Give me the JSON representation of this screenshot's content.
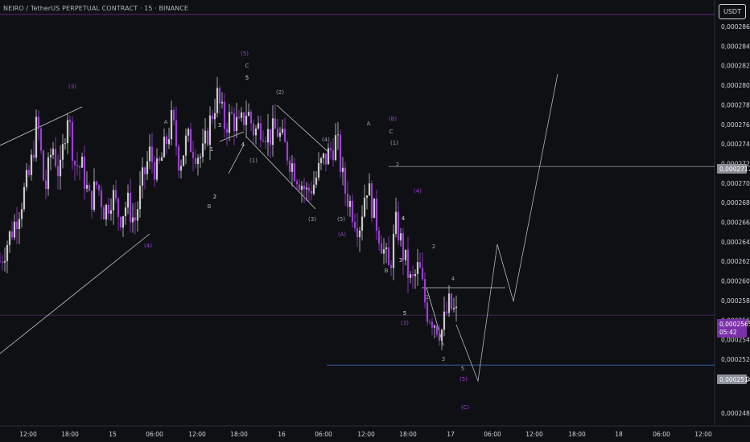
{
  "header": {
    "title": "NEIRO / TetherUS PERPETUAL CONTRACT · 15 · BINANCE"
  },
  "unit_label": "USDT",
  "colors": {
    "background": "#0f1013",
    "bull": "#c9c9c9",
    "bear": "#9b3fd6",
    "wave_label": "#9b3fd6",
    "scale_text": "#d1d4dc"
  },
  "chart_data": {
    "type": "candlestick",
    "title": "NEIRO / TetherUS PERPETUAL CONTRACT · 15 · BINANCE",
    "y_axis": {
      "ylim": [
        0.0002478,
        0.0002868
      ],
      "ticks": [
        "0,0002860",
        "0,0002840",
        "0,0002820",
        "0,0002800",
        "0,0002780",
        "0,0002760",
        "0,0002740",
        "0,0002720",
        "0,0002700",
        "0,0002680",
        "0,0002660",
        "0,0002640",
        "0,0002620",
        "0,0002600",
        "0,0002580",
        "0,0002560",
        "0,0002540",
        "0,0002520",
        "0,0002500",
        "0,0002482"
      ]
    },
    "x_axis": {
      "ticks": [
        "12:00",
        "18:00",
        "15",
        "06:00",
        "12:00",
        "18:00",
        "16",
        "06:00",
        "12:00",
        "18:00",
        "17",
        "06:00",
        "12:00",
        "18:00",
        "18",
        "06:00",
        "12:00"
      ]
    },
    "price_markers": [
      {
        "label": "0,0002717",
        "value": 0.0002717,
        "color": "#b2b5be"
      },
      {
        "label": "0,0002565",
        "sub": "05:42",
        "value": 0.0002565,
        "color": "#7b2fa8"
      },
      {
        "label": "0,0002514",
        "value": 0.0002514,
        "color": "#b2b5be"
      }
    ],
    "ohlc_path": [
      [
        0,
        0.000262
      ],
      [
        2,
        0.000266
      ],
      [
        4,
        0.000271
      ],
      [
        5,
        0.0002765
      ],
      [
        6,
        0.000269
      ],
      [
        7,
        0.000274
      ],
      [
        8,
        0.0002705
      ],
      [
        9,
        0.0002775
      ],
      [
        10,
        0.000272
      ],
      [
        11,
        0.0002715
      ],
      [
        12,
        0.000268
      ],
      [
        13,
        0.00027
      ],
      [
        14,
        0.000267
      ],
      [
        15,
        0.000269
      ],
      [
        16,
        0.0002665
      ],
      [
        17,
        0.000268
      ],
      [
        18,
        0.000266
      ],
      [
        19,
        0.00027
      ],
      [
        20,
        0.000273
      ],
      [
        21,
        0.000271
      ],
      [
        22,
        0.0002735
      ],
      [
        23,
        0.0002765
      ],
      [
        24,
        0.000272
      ],
      [
        25,
        0.0002745
      ],
      [
        26,
        0.0002735
      ],
      [
        27,
        0.0002725
      ],
      [
        28,
        0.000276
      ],
      [
        29,
        0.000279
      ],
      [
        30,
        0.000276
      ],
      [
        31,
        0.0002768
      ],
      [
        32,
        0.0002755
      ],
      [
        33,
        0.0002775
      ],
      [
        34,
        0.0002752
      ],
      [
        35,
        0.000276
      ],
      [
        36,
        0.0002748
      ],
      [
        37,
        0.0002755
      ],
      [
        38,
        0.0002738
      ],
      [
        39,
        0.000272
      ],
      [
        40,
        0.0002705
      ],
      [
        41,
        0.000269
      ],
      [
        42,
        0.00027
      ],
      [
        43,
        0.000272
      ],
      [
        44,
        0.000273
      ],
      [
        45,
        0.0002745
      ],
      [
        46,
        0.0002695
      ],
      [
        47,
        0.0002675
      ],
      [
        48,
        0.0002655
      ],
      [
        49,
        0.00027
      ],
      [
        50,
        0.000267
      ],
      [
        51,
        0.000264
      ],
      [
        52,
        0.000261
      ],
      [
        53,
        0.000266
      ],
      [
        54,
        0.0002625
      ],
      [
        55,
        0.0002595
      ],
      [
        56,
        0.0002615
      ],
      [
        57,
        0.000257
      ],
      [
        58,
        0.000256
      ],
      [
        59,
        0.0002548
      ],
      [
        60,
        0.0002575
      ],
      [
        61,
        0.0002565
      ]
    ],
    "candle_count": 190,
    "projection": [
      [
        "17 00:30",
        0.0002565
      ],
      [
        "17 02:15",
        0.0002512
      ],
      [
        "17 03:45",
        0.0002643
      ],
      [
        "17 05:15",
        0.0002589
      ],
      [
        "17 08:30",
        0.0002815
      ]
    ],
    "wave_labels": [
      {
        "text": "(3)",
        "t": 6.4,
        "v": 0.0002798,
        "color": "#9b3fd6"
      },
      {
        "text": "(4)",
        "t": 12.9,
        "v": 0.000265,
        "color": "#9b3fd6"
      },
      {
        "text": "A",
        "t": 14.8,
        "v": 0.0002762,
        "color": "#9aa0aa"
      },
      {
        "text": "B",
        "t": 18.4,
        "v": 0.0002679,
        "color": "#9aa0aa"
      },
      {
        "text": "2",
        "t": 18.9,
        "v": 0.0002689,
        "color": "#d1d4dc"
      },
      {
        "text": "1",
        "t": 18.7,
        "v": 0.0002743,
        "color": "#d1d4dc"
      },
      {
        "text": "3",
        "t": 19.4,
        "v": 0.0002758,
        "color": "#d1d4dc"
      },
      {
        "text": "4",
        "t": 21.4,
        "v": 0.0002729,
        "color": "#d1d4dc"
      },
      {
        "text": "(5)",
        "t": 21.7,
        "v": 0.000284,
        "color": "#9b3fd6"
      },
      {
        "text": "C",
        "t": 21.9,
        "v": 0.0002828,
        "color": "#9aa0aa"
      },
      {
        "text": "5",
        "t": 21.9,
        "v": 0.0002817,
        "color": "#d1d4dc"
      },
      {
        "text": "(1)",
        "t": 22.5,
        "v": 0.0002725,
        "color": "#9aa0aa"
      },
      {
        "text": "(2)",
        "t": 24.7,
        "v": 0.0002784,
        "color": "#9aa0aa"
      },
      {
        "text": "(4)",
        "t": 29.0,
        "v": 0.0002747,
        "color": "#9aa0aa"
      },
      {
        "text": "(3)",
        "t": 27.7,
        "v": 0.0002673,
        "color": "#9aa0aa"
      },
      {
        "text": "(5)",
        "t": 30.3,
        "v": 0.0002673,
        "color": "#9aa0aa"
      },
      {
        "text": "(A)",
        "t": 30.4,
        "v": 0.0002658,
        "color": "#9b3fd6"
      },
      {
        "text": "A",
        "t": 32.7,
        "v": 0.0002762,
        "color": "#9aa0aa"
      },
      {
        "text": "(B)",
        "t": 34.8,
        "v": 0.0002766,
        "color": "#9b3fd6"
      },
      {
        "text": "C",
        "t": 34.7,
        "v": 0.0002754,
        "color": "#9aa0aa"
      },
      {
        "text": "(1)",
        "t": 35.0,
        "v": 0.0002741,
        "color": "#9aa0aa"
      },
      {
        "text": "2",
        "t": 35.3,
        "v": 0.000272,
        "color": "#9aa0aa"
      },
      {
        "text": "3",
        "t": 35.5,
        "v": 0.0002625,
        "color": "#d1d4dc"
      },
      {
        "text": "B",
        "t": 34.2,
        "v": 0.0002614,
        "color": "#9aa0aa"
      },
      {
        "text": "4",
        "t": 35.8,
        "v": 0.0002666,
        "color": "#d1d4dc"
      },
      {
        "text": "(4)",
        "t": 37.1,
        "v": 0.0002691,
        "color": "#9b3fd6"
      },
      {
        "text": "2",
        "t": 38.5,
        "v": 0.0002637,
        "color": "#9aa0aa"
      },
      {
        "text": "4",
        "t": 40.2,
        "v": 0.0002603,
        "color": "#9aa0aa"
      },
      {
        "text": "5",
        "t": 35.9,
        "v": 0.0002582,
        "color": "#d1d4dc"
      },
      {
        "text": "(3)",
        "t": 35.9,
        "v": 0.000257,
        "color": "#9b3fd6"
      },
      {
        "text": "1",
        "t": 38.0,
        "v": 0.0002587,
        "color": "#9aa0aa"
      },
      {
        "text": "3",
        "t": 39.5,
        "v": 0.0002535,
        "color": "#9aa0aa"
      },
      {
        "text": "5",
        "t": 41.0,
        "v": 0.0002523,
        "color": "#9aa0aa"
      },
      {
        "text": "(5)",
        "t": 41.1,
        "v": 0.0002512,
        "color": "#9b3fd6"
      },
      {
        "text": "(C)",
        "t": 41.3,
        "v": 0.0002486,
        "color": "#9b3fd6"
      }
    ],
    "trend_lines": [
      {
        "from": [
          0,
          0.000275
        ],
        "to": [
          7.3,
          0.000278
        ]
      },
      {
        "from": [
          0,
          0.0002547
        ],
        "to": [
          13.2,
          0.0002652
        ]
      },
      {
        "from": [
          20.3,
          0.000272
        ],
        "to": [
          21.5,
          0.000276
        ]
      },
      {
        "from": [
          19.5,
          0.0002757
        ],
        "to": [
          21.5,
          0.0002765
        ]
      },
      {
        "from": [
          24.4,
          0.000278
        ],
        "to": [
          29.2,
          0.0002738
        ]
      },
      {
        "from": [
          21.9,
          0.0002757
        ],
        "to": [
          27.8,
          0.0002682
        ]
      },
      {
        "from": [
          37.3,
          0.0002599
        ],
        "to": [
          44.7,
          0.0002599
        ]
      },
      {
        "from": [
          37.8,
          0.00026
        ],
        "to": [
          39.4,
          0.0002545
        ]
      },
      {
        "from": [
          34.6,
          0.0002717
        ],
        "to": [
          63.2,
          0.0002717
        ]
      },
      {
        "from": [
          29.0,
          0.0002514
        ],
        "to": [
          63.2,
          0.0002514
        ]
      },
      {
        "from": [
          0,
          0.0002565
        ],
        "to": [
          63.2,
          0.0002565
        ]
      },
      {
        "from": [
          0,
          0.000286
        ],
        "to": [
          63.2,
          0.000286
        ]
      }
    ]
  }
}
